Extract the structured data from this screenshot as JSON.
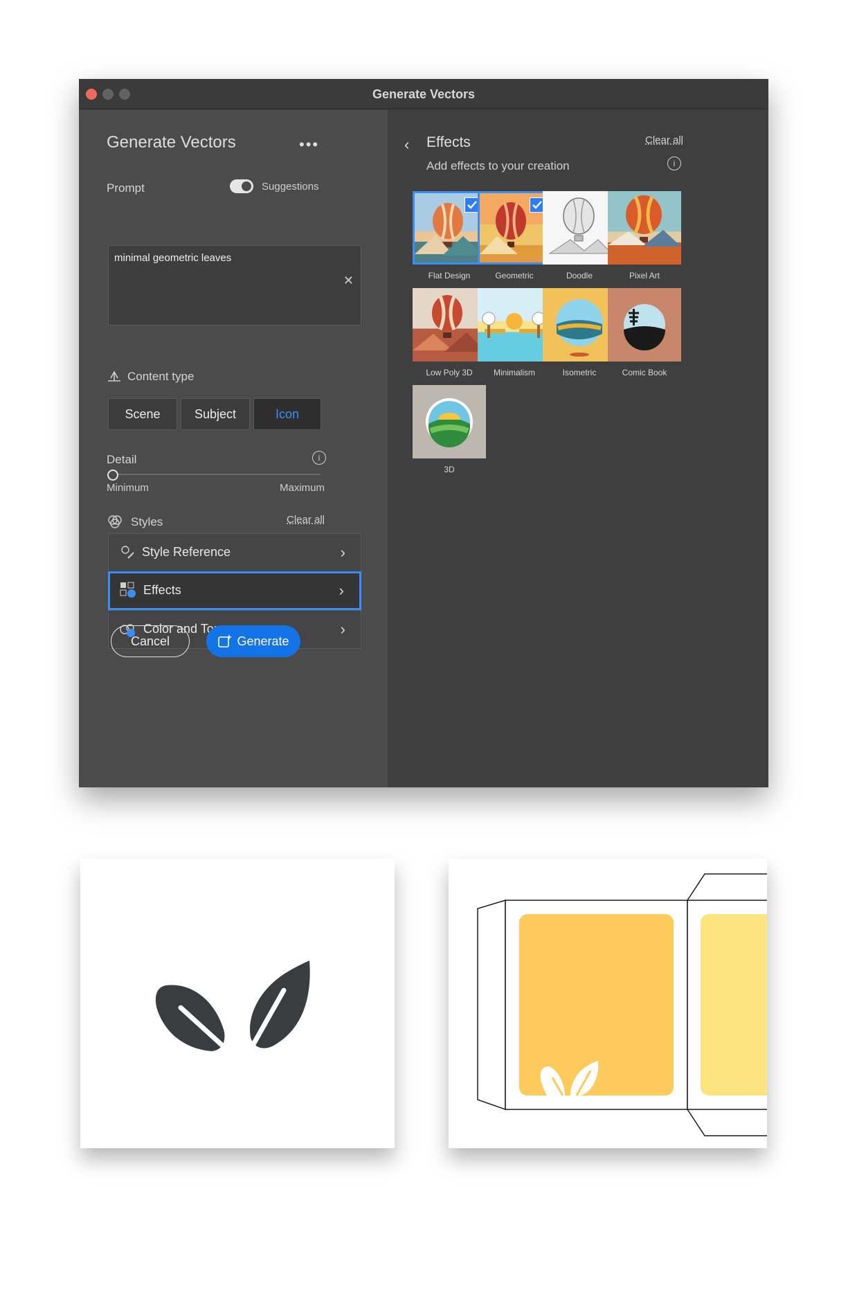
{
  "window": {
    "title": "Generate Vectors"
  },
  "panel": {
    "title": "Generate Vectors",
    "more_icon": "ellipsis-icon",
    "prompt_label": "Prompt",
    "suggestions_label": "Suggestions",
    "suggestions_on": true,
    "prompt_value": "minimal geometric leaves",
    "content_type_label": "Content type",
    "content_types": [
      "Scene",
      "Subject",
      "Icon"
    ],
    "content_type_selected": "Icon",
    "detail_label": "Detail",
    "detail_min": "Minimum",
    "detail_max": "Maximum",
    "detail_value": 0,
    "styles_label": "Styles",
    "styles_clear": "Clear all",
    "style_rows": [
      "Style Reference",
      "Effects",
      "Color and Tone"
    ],
    "cancel": "Cancel",
    "generate": "Generate"
  },
  "effects": {
    "title": "Effects",
    "subtitle": "Add effects to your creation",
    "clear": "Clear all",
    "items": [
      {
        "label": "Flat Design",
        "selected": true
      },
      {
        "label": "Geometric",
        "selected": true
      },
      {
        "label": "Doodle",
        "selected": false
      },
      {
        "label": "Pixel Art",
        "selected": false
      },
      {
        "label": "Low Poly 3D",
        "selected": false
      },
      {
        "label": "Minimalism",
        "selected": false
      },
      {
        "label": "Isometric",
        "selected": false
      },
      {
        "label": "Comic Book",
        "selected": false
      },
      {
        "label": "3D",
        "selected": false
      }
    ]
  },
  "colors": {
    "accent": "#3b8df3",
    "leaf": "#3a3d40",
    "package": "#fdca5b",
    "package_side": "#fde480"
  }
}
